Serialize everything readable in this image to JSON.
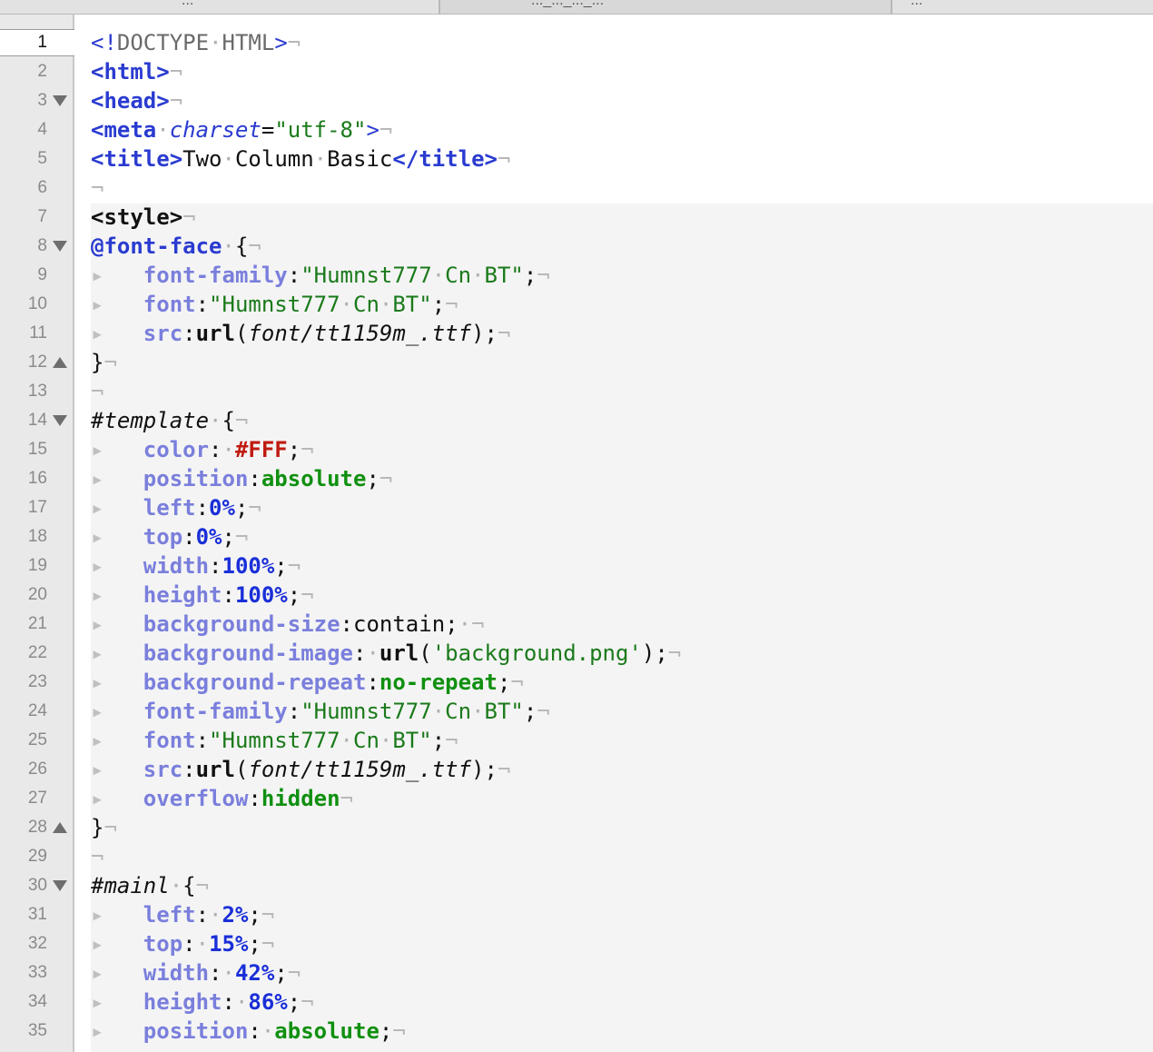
{
  "tabs": [
    {
      "label": "..."
    },
    {
      "label": "..._..._..._..."
    },
    {
      "label": "..."
    }
  ],
  "current_line": 1,
  "lines": [
    {
      "n": "1",
      "fold": "",
      "tokens": [
        {
          "c": "k-tagdoc",
          "t": "<!"
        },
        {
          "c": "k-doctype",
          "t": "DOCTYPE"
        },
        {
          "c": "k-dot",
          "t": "·"
        },
        {
          "c": "k-doctype",
          "t": "HTML"
        },
        {
          "c": "k-tagdoc",
          "t": ">"
        },
        {
          "c": "k-inv",
          "t": "¬"
        }
      ]
    },
    {
      "n": "2",
      "fold": "",
      "tokens": [
        {
          "c": "k-tag",
          "t": "<html>"
        },
        {
          "c": "k-inv",
          "t": "¬"
        }
      ]
    },
    {
      "n": "3",
      "fold": "open",
      "tokens": [
        {
          "c": "k-tag",
          "t": "<head>"
        },
        {
          "c": "k-inv",
          "t": "¬"
        }
      ]
    },
    {
      "n": "4",
      "fold": "",
      "tokens": [
        {
          "c": "k-tag",
          "t": "<meta"
        },
        {
          "c": "k-dot",
          "t": "·"
        },
        {
          "c": "k-attr",
          "t": "charset"
        },
        {
          "c": "k-punc",
          "t": "="
        },
        {
          "c": "k-str",
          "t": "\"utf-8\""
        },
        {
          "c": "k-tagdoc",
          "t": ">"
        },
        {
          "c": "k-inv",
          "t": "¬"
        }
      ]
    },
    {
      "n": "5",
      "fold": "",
      "tokens": [
        {
          "c": "k-tag",
          "t": "<title>"
        },
        {
          "c": "k-text",
          "t": "Two"
        },
        {
          "c": "k-dot",
          "t": "·"
        },
        {
          "c": "k-text",
          "t": "Column"
        },
        {
          "c": "k-dot",
          "t": "·"
        },
        {
          "c": "k-text",
          "t": "Basic"
        },
        {
          "c": "k-tag",
          "t": "</title>"
        },
        {
          "c": "k-inv",
          "t": "¬"
        }
      ]
    },
    {
      "n": "6",
      "fold": "",
      "tokens": [
        {
          "c": "k-inv",
          "t": "¬"
        }
      ]
    },
    {
      "n": "7",
      "fold": "",
      "tokens": [
        {
          "c": "k-bold",
          "t": "<style>"
        },
        {
          "c": "k-inv",
          "t": "¬"
        }
      ]
    },
    {
      "n": "8",
      "fold": "open",
      "tokens": [
        {
          "c": "k-kw",
          "t": "@font-face"
        },
        {
          "c": "k-dot",
          "t": "·"
        },
        {
          "c": "k-punc",
          "t": "{"
        },
        {
          "c": "k-inv",
          "t": "¬"
        }
      ]
    },
    {
      "n": "9",
      "fold": "",
      "tokens": [
        {
          "c": "k-tabmark",
          "t": "▸   "
        },
        {
          "c": "k-prop",
          "t": "font-family"
        },
        {
          "c": "k-punc",
          "t": ":"
        },
        {
          "c": "k-str",
          "t": "\"Humnst777"
        },
        {
          "c": "k-dot",
          "t": "·"
        },
        {
          "c": "k-str",
          "t": "Cn"
        },
        {
          "c": "k-dot",
          "t": "·"
        },
        {
          "c": "k-str",
          "t": "BT\""
        },
        {
          "c": "k-punc",
          "t": ";"
        },
        {
          "c": "k-inv",
          "t": "¬"
        }
      ]
    },
    {
      "n": "10",
      "fold": "",
      "tokens": [
        {
          "c": "k-tabmark",
          "t": "▸   "
        },
        {
          "c": "k-prop",
          "t": "font"
        },
        {
          "c": "k-punc",
          "t": ":"
        },
        {
          "c": "k-str",
          "t": "\"Humnst777"
        },
        {
          "c": "k-dot",
          "t": "·"
        },
        {
          "c": "k-str",
          "t": "Cn"
        },
        {
          "c": "k-dot",
          "t": "·"
        },
        {
          "c": "k-str",
          "t": "BT\""
        },
        {
          "c": "k-punc",
          "t": ";"
        },
        {
          "c": "k-inv",
          "t": "¬"
        }
      ]
    },
    {
      "n": "11",
      "fold": "",
      "tokens": [
        {
          "c": "k-tabmark",
          "t": "▸   "
        },
        {
          "c": "k-prop",
          "t": "src"
        },
        {
          "c": "k-punc",
          "t": ":"
        },
        {
          "c": "k-fn",
          "t": "url"
        },
        {
          "c": "k-punc",
          "t": "("
        },
        {
          "c": "k-ital",
          "t": "font/tt1159m_.ttf"
        },
        {
          "c": "k-punc",
          "t": ");"
        },
        {
          "c": "k-inv",
          "t": "¬"
        }
      ]
    },
    {
      "n": "12",
      "fold": "close",
      "tokens": [
        {
          "c": "k-punc",
          "t": "}"
        },
        {
          "c": "k-inv",
          "t": "¬"
        }
      ]
    },
    {
      "n": "13",
      "fold": "",
      "tokens": [
        {
          "c": "k-inv",
          "t": "¬"
        }
      ]
    },
    {
      "n": "14",
      "fold": "open",
      "tokens": [
        {
          "c": "k-id",
          "t": "#template"
        },
        {
          "c": "k-dot",
          "t": "·"
        },
        {
          "c": "k-punc",
          "t": "{"
        },
        {
          "c": "k-inv",
          "t": "¬"
        }
      ]
    },
    {
      "n": "15",
      "fold": "",
      "tokens": [
        {
          "c": "k-tabmark",
          "t": "▸   "
        },
        {
          "c": "k-prop",
          "t": "color"
        },
        {
          "c": "k-punc",
          "t": ":"
        },
        {
          "c": "k-dot",
          "t": "·"
        },
        {
          "c": "k-color",
          "t": "#FFF"
        },
        {
          "c": "k-punc",
          "t": ";"
        },
        {
          "c": "k-inv",
          "t": "¬"
        }
      ]
    },
    {
      "n": "16",
      "fold": "",
      "tokens": [
        {
          "c": "k-tabmark",
          "t": "▸   "
        },
        {
          "c": "k-prop",
          "t": "position"
        },
        {
          "c": "k-punc",
          "t": ":"
        },
        {
          "c": "k-val",
          "t": "absolute"
        },
        {
          "c": "k-punc",
          "t": ";"
        },
        {
          "c": "k-inv",
          "t": "¬"
        }
      ]
    },
    {
      "n": "17",
      "fold": "",
      "tokens": [
        {
          "c": "k-tabmark",
          "t": "▸   "
        },
        {
          "c": "k-prop",
          "t": "left"
        },
        {
          "c": "k-punc",
          "t": ":"
        },
        {
          "c": "k-num",
          "t": "0%"
        },
        {
          "c": "k-punc",
          "t": ";"
        },
        {
          "c": "k-inv",
          "t": "¬"
        }
      ]
    },
    {
      "n": "18",
      "fold": "",
      "tokens": [
        {
          "c": "k-tabmark",
          "t": "▸   "
        },
        {
          "c": "k-prop",
          "t": "top"
        },
        {
          "c": "k-punc",
          "t": ":"
        },
        {
          "c": "k-num",
          "t": "0%"
        },
        {
          "c": "k-punc",
          "t": ";"
        },
        {
          "c": "k-inv",
          "t": "¬"
        }
      ]
    },
    {
      "n": "19",
      "fold": "",
      "tokens": [
        {
          "c": "k-tabmark",
          "t": "▸   "
        },
        {
          "c": "k-prop",
          "t": "width"
        },
        {
          "c": "k-punc",
          "t": ":"
        },
        {
          "c": "k-num",
          "t": "100%"
        },
        {
          "c": "k-punc",
          "t": ";"
        },
        {
          "c": "k-inv",
          "t": "¬"
        }
      ]
    },
    {
      "n": "20",
      "fold": "",
      "tokens": [
        {
          "c": "k-tabmark",
          "t": "▸   "
        },
        {
          "c": "k-prop",
          "t": "height"
        },
        {
          "c": "k-punc",
          "t": ":"
        },
        {
          "c": "k-num",
          "t": "100%"
        },
        {
          "c": "k-punc",
          "t": ";"
        },
        {
          "c": "k-inv",
          "t": "¬"
        }
      ]
    },
    {
      "n": "21",
      "fold": "",
      "tokens": [
        {
          "c": "k-tabmark",
          "t": "▸   "
        },
        {
          "c": "k-prop",
          "t": "background-size"
        },
        {
          "c": "k-punc",
          "t": ":"
        },
        {
          "c": "k-plain",
          "t": "contain"
        },
        {
          "c": "k-punc",
          "t": ";"
        },
        {
          "c": "k-dot",
          "t": "·"
        },
        {
          "c": "k-inv",
          "t": "¬"
        }
      ]
    },
    {
      "n": "22",
      "fold": "",
      "tokens": [
        {
          "c": "k-tabmark",
          "t": "▸   "
        },
        {
          "c": "k-prop",
          "t": "background-image"
        },
        {
          "c": "k-punc",
          "t": ":"
        },
        {
          "c": "k-dot",
          "t": "·"
        },
        {
          "c": "k-fn",
          "t": "url"
        },
        {
          "c": "k-punc",
          "t": "("
        },
        {
          "c": "k-str",
          "t": "'background.png'"
        },
        {
          "c": "k-punc",
          "t": ");"
        },
        {
          "c": "k-inv",
          "t": "¬"
        }
      ]
    },
    {
      "n": "23",
      "fold": "",
      "tokens": [
        {
          "c": "k-tabmark",
          "t": "▸   "
        },
        {
          "c": "k-prop",
          "t": "background-repeat"
        },
        {
          "c": "k-punc",
          "t": ":"
        },
        {
          "c": "k-val",
          "t": "no-repeat"
        },
        {
          "c": "k-punc",
          "t": ";"
        },
        {
          "c": "k-inv",
          "t": "¬"
        }
      ]
    },
    {
      "n": "24",
      "fold": "",
      "tokens": [
        {
          "c": "k-tabmark",
          "t": "▸   "
        },
        {
          "c": "k-prop",
          "t": "font-family"
        },
        {
          "c": "k-punc",
          "t": ":"
        },
        {
          "c": "k-str",
          "t": "\"Humnst777"
        },
        {
          "c": "k-dot",
          "t": "·"
        },
        {
          "c": "k-str",
          "t": "Cn"
        },
        {
          "c": "k-dot",
          "t": "·"
        },
        {
          "c": "k-str",
          "t": "BT\""
        },
        {
          "c": "k-punc",
          "t": ";"
        },
        {
          "c": "k-inv",
          "t": "¬"
        }
      ]
    },
    {
      "n": "25",
      "fold": "",
      "tokens": [
        {
          "c": "k-tabmark",
          "t": "▸   "
        },
        {
          "c": "k-prop",
          "t": "font"
        },
        {
          "c": "k-punc",
          "t": ":"
        },
        {
          "c": "k-str",
          "t": "\"Humnst777"
        },
        {
          "c": "k-dot",
          "t": "·"
        },
        {
          "c": "k-str",
          "t": "Cn"
        },
        {
          "c": "k-dot",
          "t": "·"
        },
        {
          "c": "k-str",
          "t": "BT\""
        },
        {
          "c": "k-punc",
          "t": ";"
        },
        {
          "c": "k-inv",
          "t": "¬"
        }
      ]
    },
    {
      "n": "26",
      "fold": "",
      "tokens": [
        {
          "c": "k-tabmark",
          "t": "▸   "
        },
        {
          "c": "k-prop",
          "t": "src"
        },
        {
          "c": "k-punc",
          "t": ":"
        },
        {
          "c": "k-fn",
          "t": "url"
        },
        {
          "c": "k-punc",
          "t": "("
        },
        {
          "c": "k-ital",
          "t": "font/tt1159m_.ttf"
        },
        {
          "c": "k-punc",
          "t": ");"
        },
        {
          "c": "k-inv",
          "t": "¬"
        }
      ]
    },
    {
      "n": "27",
      "fold": "",
      "tokens": [
        {
          "c": "k-tabmark",
          "t": "▸   "
        },
        {
          "c": "k-prop",
          "t": "overflow"
        },
        {
          "c": "k-punc",
          "t": ":"
        },
        {
          "c": "k-val",
          "t": "hidden"
        },
        {
          "c": "k-inv",
          "t": "¬"
        }
      ]
    },
    {
      "n": "28",
      "fold": "close",
      "tokens": [
        {
          "c": "k-punc",
          "t": "}"
        },
        {
          "c": "k-inv",
          "t": "¬"
        }
      ]
    },
    {
      "n": "29",
      "fold": "",
      "tokens": [
        {
          "c": "k-inv",
          "t": "¬"
        }
      ]
    },
    {
      "n": "30",
      "fold": "open",
      "tokens": [
        {
          "c": "k-id",
          "t": "#mainl"
        },
        {
          "c": "k-dot",
          "t": "·"
        },
        {
          "c": "k-punc",
          "t": "{"
        },
        {
          "c": "k-inv",
          "t": "¬"
        }
      ]
    },
    {
      "n": "31",
      "fold": "",
      "tokens": [
        {
          "c": "k-tabmark",
          "t": "▸   "
        },
        {
          "c": "k-prop",
          "t": "left"
        },
        {
          "c": "k-punc",
          "t": ":"
        },
        {
          "c": "k-dot",
          "t": "·"
        },
        {
          "c": "k-num",
          "t": "2%"
        },
        {
          "c": "k-punc",
          "t": ";"
        },
        {
          "c": "k-inv",
          "t": "¬"
        }
      ]
    },
    {
      "n": "32",
      "fold": "",
      "tokens": [
        {
          "c": "k-tabmark",
          "t": "▸   "
        },
        {
          "c": "k-prop",
          "t": "top"
        },
        {
          "c": "k-punc",
          "t": ":"
        },
        {
          "c": "k-dot",
          "t": "·"
        },
        {
          "c": "k-num",
          "t": "15%"
        },
        {
          "c": "k-punc",
          "t": ";"
        },
        {
          "c": "k-inv",
          "t": "¬"
        }
      ]
    },
    {
      "n": "33",
      "fold": "",
      "tokens": [
        {
          "c": "k-tabmark",
          "t": "▸   "
        },
        {
          "c": "k-prop",
          "t": "width"
        },
        {
          "c": "k-punc",
          "t": ":"
        },
        {
          "c": "k-dot",
          "t": "·"
        },
        {
          "c": "k-num",
          "t": "42%"
        },
        {
          "c": "k-punc",
          "t": ";"
        },
        {
          "c": "k-inv",
          "t": "¬"
        }
      ]
    },
    {
      "n": "34",
      "fold": "",
      "tokens": [
        {
          "c": "k-tabmark",
          "t": "▸   "
        },
        {
          "c": "k-prop",
          "t": "height"
        },
        {
          "c": "k-punc",
          "t": ":"
        },
        {
          "c": "k-dot",
          "t": "·"
        },
        {
          "c": "k-num",
          "t": "86%"
        },
        {
          "c": "k-punc",
          "t": ";"
        },
        {
          "c": "k-inv",
          "t": "¬"
        }
      ]
    },
    {
      "n": "35",
      "fold": "",
      "tokens": [
        {
          "c": "k-tabmark",
          "t": "▸   "
        },
        {
          "c": "k-prop",
          "t": "position"
        },
        {
          "c": "k-punc",
          "t": ":"
        },
        {
          "c": "k-dot",
          "t": "·"
        },
        {
          "c": "k-val",
          "t": "absolute"
        },
        {
          "c": "k-punc",
          "t": ";"
        },
        {
          "c": "k-inv",
          "t": "¬"
        }
      ]
    }
  ]
}
